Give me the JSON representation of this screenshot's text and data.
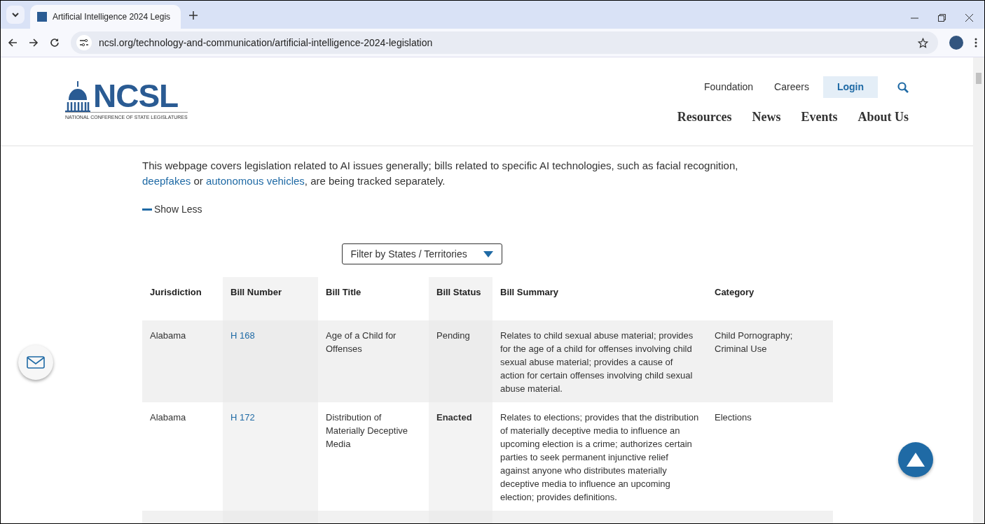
{
  "browser": {
    "tab_title": "Artificial Intelligence 2024 Legis",
    "url": "ncsl.org/technology-and-communication/artificial-intelligence-2024-legislation"
  },
  "header": {
    "logo_text": "NCSL",
    "logo_subtitle": "NATIONAL CONFERENCE OF STATE LEGISLATURES",
    "utility_links": [
      {
        "label": "Foundation",
        "selected": false
      },
      {
        "label": "Careers",
        "selected": false
      },
      {
        "label": "Login",
        "selected": true
      }
    ],
    "nav": [
      "Resources",
      "News",
      "Events",
      "About Us"
    ]
  },
  "intro": {
    "text_before": "This webpage covers legislation related to AI issues generally; bills related to specific AI technologies, such as facial recognition,",
    "links": [
      "deepfakes",
      "autonomous vehicles"
    ],
    "connector": "or",
    "text_after": ", are being tracked separately."
  },
  "show_less": "Show Less",
  "filter": {
    "label": "Filter by States / Territories"
  },
  "table": {
    "columns": [
      "Jurisdiction",
      "Bill Number",
      "Bill Title",
      "Bill Status",
      "Bill Summary",
      "Category"
    ],
    "rows": [
      {
        "jurisdiction": "Alabama",
        "bill_number": "H 168",
        "bill_title": "Age of a Child for Offenses",
        "bill_status": "Pending",
        "status_bold": false,
        "bill_summary": "Relates to child sexual abuse material; provides for the age of a child for offenses involving child sexual abuse material; provides a cause of action for certain offenses involving child sexual abuse material.",
        "category": "Child Pornography; Criminal Use"
      },
      {
        "jurisdiction": "Alabama",
        "bill_number": "H 172",
        "bill_title": "Distribution of Materially Deceptive Media",
        "bill_status": "Enacted",
        "status_bold": true,
        "bill_summary": "Relates to elections; provides that the distribution of materially deceptive media to influence an upcoming election is a crime; authorizes certain parties to seek permanent injunctive relief against anyone who distributes materially deceptive media to influence an upcoming election; provides definitions.",
        "category": "Elections"
      }
    ]
  }
}
